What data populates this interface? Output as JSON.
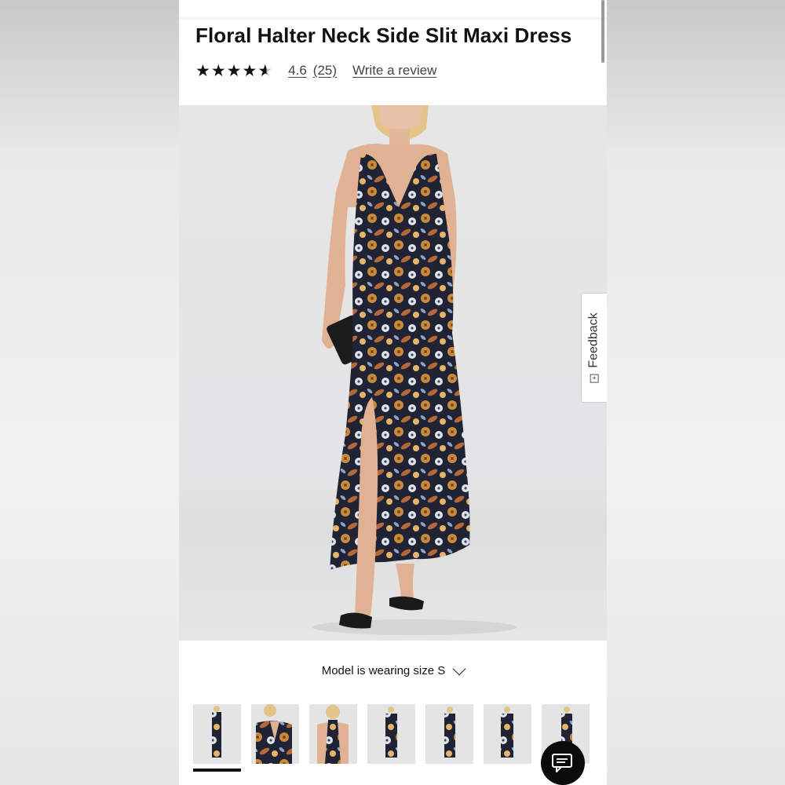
{
  "product": {
    "title": "Floral Halter Neck Side Slit Maxi Dress",
    "rating_value": "4.6",
    "rating_count": "(25)",
    "rating_stars": 4.6,
    "write_review_label": "Write a review"
  },
  "feedback": {
    "label": "Feedback"
  },
  "model_info": {
    "label": "Model is wearing size S"
  },
  "gallery": {
    "thumbnail_count": 7,
    "selected_index": 0
  },
  "colors": {
    "text": "#111111",
    "dress_dark": "#1f2333",
    "dress_accent": "#c98a3e",
    "chat_button": "#0b0b0b"
  },
  "icons": {
    "chat": "chat-bubble-icon",
    "chevron": "chevron-down-icon",
    "feedback": "feedback-icon"
  }
}
